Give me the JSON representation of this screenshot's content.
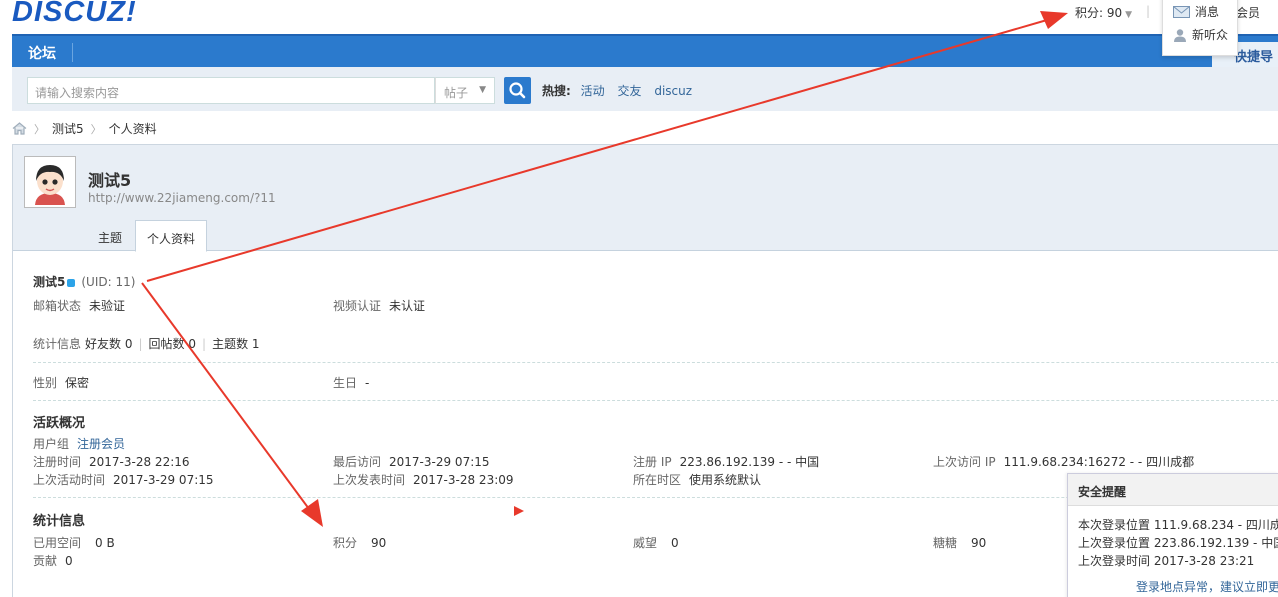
{
  "header": {
    "logo": "DISCUZ!",
    "points": "积分: 90",
    "member": "会员",
    "popup": {
      "messages": "消息",
      "new_listener": "新听众"
    }
  },
  "nav": {
    "forum": "论坛",
    "quick": "快捷导"
  },
  "search": {
    "placeholder": "请输入搜索内容",
    "select": "帖子",
    "hot_label": "热搜:",
    "hot": [
      "活动",
      "交友",
      "discuz"
    ]
  },
  "breadcrumb": {
    "user": "测试5",
    "page": "个人资料"
  },
  "profile": {
    "name": "测试5",
    "url": "http://www.22jiameng.com/?11",
    "tabs": [
      "主题",
      "个人资料"
    ],
    "uid": "(UID: 11)",
    "email_label": "邮箱状态",
    "email_value": "未验证",
    "video_label": "视频认证",
    "video_value": "未认证",
    "stats_label": "统计信息",
    "friends_label": "好友数",
    "friends_value": "0",
    "replies_label": "回帖数",
    "replies_value": "0",
    "threads_label": "主题数",
    "threads_value": "1",
    "gender_label": "性别",
    "gender_value": "保密",
    "birthday_label": "生日",
    "birthday_value": "-"
  },
  "activity": {
    "title": "活跃概况",
    "group_label": "用户组",
    "group_value": "注册会员",
    "reg_time_label": "注册时间",
    "reg_time": "2017-3-28 22:16",
    "last_visit_label": "最后访问",
    "last_visit": "2017-3-29 07:15",
    "reg_ip_label": "注册 IP",
    "reg_ip": "223.86.192.139 - - 中国",
    "last_ip_label": "上次访问 IP",
    "last_ip": "111.9.68.234:16272 - - 四川成都",
    "last_active_label": "上次活动时间",
    "last_active": "2017-3-29 07:15",
    "last_post_label": "上次发表时间",
    "last_post": "2017-3-28 23:09",
    "timezone_label": "所在时区",
    "timezone": "使用系统默认"
  },
  "stats": {
    "title": "统计信息",
    "space_label": "已用空间",
    "space": "0 B",
    "points_label": "积分",
    "points": "90",
    "prestige_label": "威望",
    "prestige": "0",
    "candy_label": "糖糖",
    "candy": "90",
    "contrib_label": "贡献",
    "contrib": "0"
  },
  "safety": {
    "title": "安全提醒",
    "current": "本次登录位置 111.9.68.234 - 四川成",
    "last_location": "上次登录位置 223.86.192.139 - 中国",
    "last_time": "上次登录时间 2017-3-28 23:21",
    "link": "登录地点异常，建议立即更"
  },
  "colors": {
    "nav": "#2b7acd",
    "annotation": "#e8392b",
    "link": "#336699"
  }
}
